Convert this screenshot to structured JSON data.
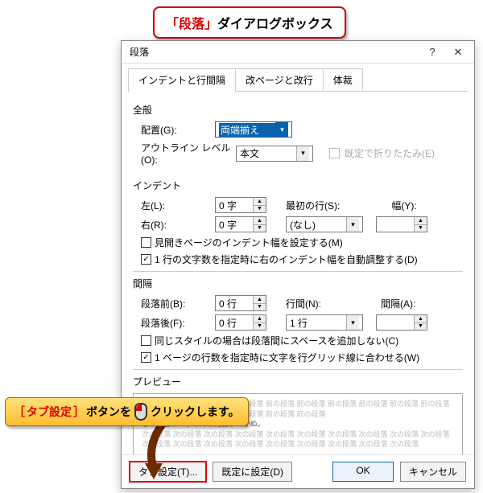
{
  "top_callout": {
    "quote_open": "「",
    "word": "段落",
    "quote_close": "」",
    "rest": "ダイアログボックス"
  },
  "dialog": {
    "title": "段落",
    "help": "?",
    "close": "✕",
    "tabs": {
      "indent": "インデントと行間隔",
      "page": "改ページと改行",
      "style": "体裁"
    },
    "general": {
      "heading": "全般",
      "align_label": "配置(G):",
      "align_value": "両端揃え",
      "outline_label": "アウトライン レベル(O):",
      "outline_value": "本文",
      "fold_label": "既定で折りたたみ(E)"
    },
    "indent": {
      "heading": "インデント",
      "left_label": "左(L):",
      "left_value": "0 字",
      "right_label": "右(R):",
      "right_value": "0 字",
      "firstline_label": "最初の行(S):",
      "firstline_value": "(なし)",
      "width_label": "幅(Y):",
      "mirror_label": "見開きページのインデント幅を設定する(M)",
      "auto_label": "1 行の文字数を指定時に右のインデント幅を自動調整する(D)"
    },
    "spacing": {
      "heading": "間隔",
      "before_label": "段落前(B):",
      "before_value": "0 行",
      "after_label": "段落後(F):",
      "after_value": "0 行",
      "lineht_label": "行間(N):",
      "lineht_value": "1 行",
      "amount_label": "間隔(A):",
      "nospace_label": "同じスタイルの場合は段落間にスペースを追加しない(C)",
      "grid_label": "1 ページの行数を指定時に文字を行グリッド線に合わせる(W)"
    },
    "preview": {
      "heading": "プレビュー",
      "grey_line": "前の段落 前の段落 前の段落 前の段落 前の段落 前の段落 前の段落 前の段落 前の段落 前の段落 前の段落 前の段落 前の段落 前の段落 前の段落 前の段落",
      "dark_line": "どこで生れたかとんと見当がつかぬ。",
      "grey_line2": "次の段落 次の段落 次の段落 次の段落 次の段落 次の段落 次の段落 次の段落 次の段落 次の段落 次の段落 次の段落 次の段落 次の段落 次の段落 次の段落 次の段落 次の段落 次の段落"
    },
    "buttons": {
      "tabs": "タブ設定(T)...",
      "default": "既定に設定(D)",
      "ok": "OK",
      "cancel": "キャンセル"
    }
  },
  "left_callout": {
    "bracket_open": "［",
    "word": "タブ設定",
    "bracket_close": "］",
    "mid": "ボタンを",
    "end": "クリックします。"
  }
}
